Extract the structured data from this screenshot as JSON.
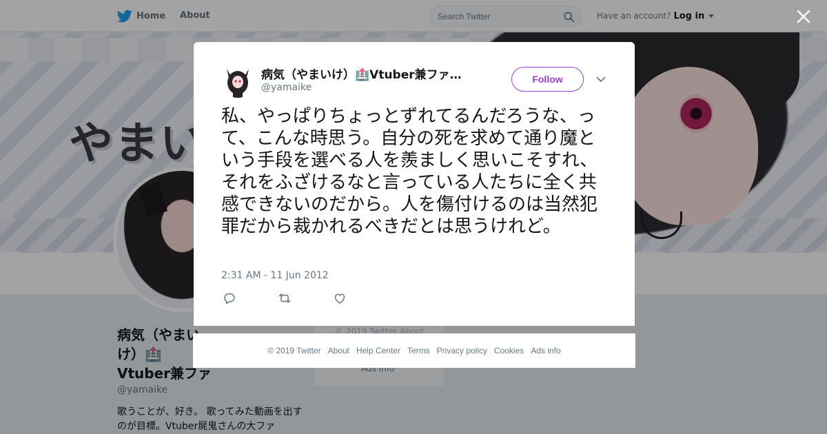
{
  "topbar": {
    "home_label": "Home",
    "about_label": "About",
    "search_placeholder": "Search Twitter",
    "account_prompt": "Have an account?",
    "login_label": "Log in"
  },
  "banner": {
    "logo_text": "やまい"
  },
  "profile": {
    "name": "病気（やまいけ）🏥Vtuber兼ファム",
    "handle": "@yamaike",
    "bio": "歌うことが、好き。 歌ってみた動画を出すのが目標。Vtuber屍鬼さんの大ファ"
  },
  "side_footer": {
    "line1": "© 2019 Twitter   About",
    "line2": "Ads info"
  },
  "tweet": {
    "display_name": "病気（やまいけ）🏥Vtuber兼ファ…",
    "handle": "@yamaike",
    "follow_label": "Follow",
    "text": "私、やっぱりちょっとずれてるんだろうな、って、こんな時思う。自分の死を求めて通り魔という手段を選べる人を羨ましく思いこそすれ、それをふざけるなと言っている人たちに全く共感できないのだから。人を傷付けるのは当然犯罪だから裁かれるべきだとは思うけれど。",
    "timestamp": "2:31 AM - 11 Jun 2012"
  },
  "footer": {
    "copyright": "© 2019 Twitter",
    "links": [
      "About",
      "Help Center",
      "Terms",
      "Privacy policy",
      "Cookies",
      "Ads info"
    ]
  },
  "colors": {
    "twitter_blue": "#1da1f2",
    "follow_purple": "#9b3bd6",
    "muted_text": "#657786"
  },
  "icons": [
    "twitter-bird-icon",
    "search-icon",
    "close-icon",
    "chevron-down-icon",
    "reply-icon",
    "retweet-icon",
    "like-icon"
  ]
}
